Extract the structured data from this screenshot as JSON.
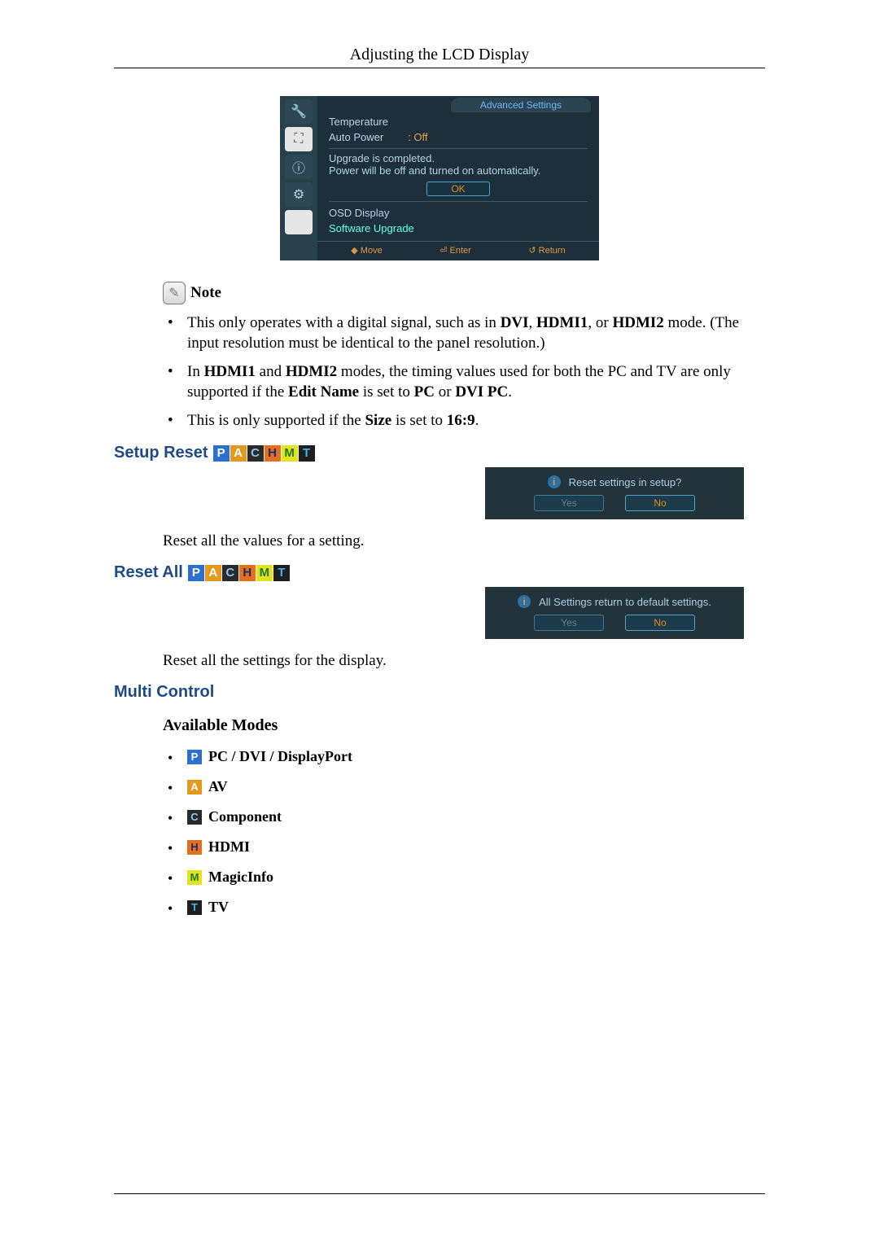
{
  "header": {
    "title": "Adjusting the LCD Display"
  },
  "osd": {
    "tab": "Advanced Settings",
    "rows": [
      {
        "label": "Temperature",
        "value": ""
      },
      {
        "label": "Auto Power",
        "value": ": Off"
      }
    ],
    "message_line1": "Upgrade is completed.",
    "message_line2": "Power will be off and turned on automatically.",
    "ok": "OK",
    "items": [
      {
        "label": "OSD Display",
        "active": false
      },
      {
        "label": "Software Upgrade",
        "active": true
      }
    ],
    "footer": {
      "move": "◆ Move",
      "enter": "⏎ Enter",
      "return": "↺ Return"
    }
  },
  "note_label": "Note",
  "notes": [
    {
      "parts": [
        "This only operates with a digital signal, such as in ",
        "DVI",
        ", ",
        "HDMI1",
        ", or ",
        "HDMI2",
        " mode. (The input resolution must be identical to the panel resolution.)"
      ]
    },
    {
      "parts": [
        "In ",
        "HDMI1",
        " and ",
        "HDMI2",
        " modes, the timing values used for both the PC and TV are only supported if the ",
        "Edit Name",
        " is set to ",
        "PC",
        " or ",
        "DVI PC",
        "."
      ]
    },
    {
      "parts": [
        "This is only supported if the ",
        "Size",
        " is set to ",
        "16:9",
        "."
      ]
    }
  ],
  "setup_reset": {
    "title": "Setup Reset",
    "dialog": {
      "question": "Reset settings in setup?",
      "yes": "Yes",
      "no": "No"
    },
    "desc": "Reset all the values for a setting."
  },
  "reset_all": {
    "title": "Reset All",
    "dialog": {
      "question": "All Settings return to default settings.",
      "yes": "Yes",
      "no": "No"
    },
    "desc": "Reset all the settings for the display."
  },
  "multi_control": {
    "title": "Multi Control",
    "avail": "Available Modes",
    "modes": [
      {
        "code": "P",
        "label": " PC / DVI / DisplayPort"
      },
      {
        "code": "A",
        "label": " AV"
      },
      {
        "code": "C",
        "label": " Component"
      },
      {
        "code": "H",
        "label": " HDMI"
      },
      {
        "code": "M",
        "label": " MagicInfo"
      },
      {
        "code": "T",
        "label": " TV"
      }
    ]
  },
  "mode_codes": [
    "P",
    "A",
    "C",
    "H",
    "M",
    "T"
  ]
}
